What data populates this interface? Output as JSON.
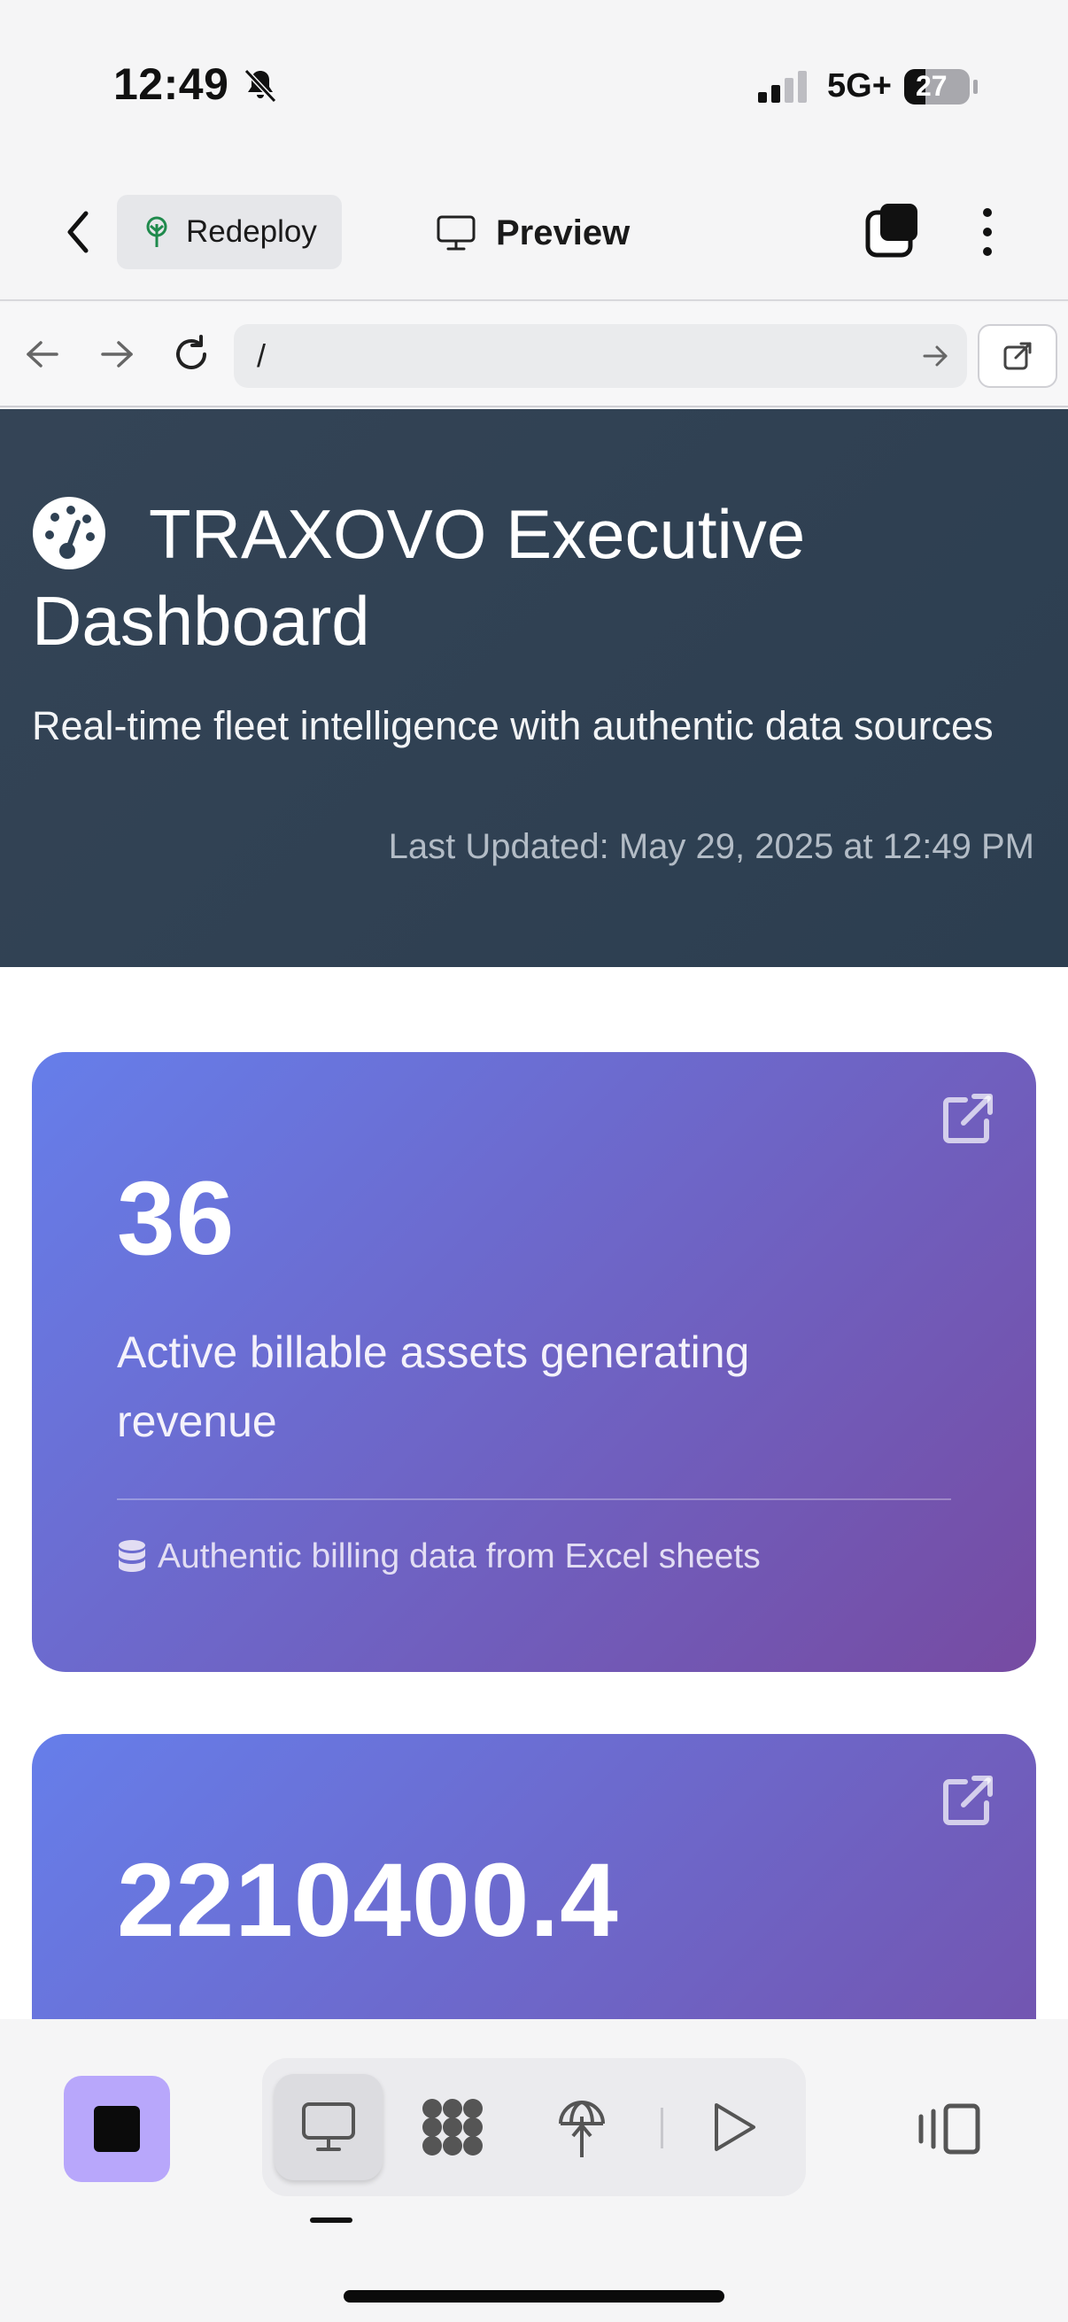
{
  "status_bar": {
    "time": "12:49",
    "network": "5G+",
    "battery": "27",
    "icons": [
      "bell-slash-icon",
      "signal-icon",
      "battery-icon"
    ]
  },
  "toolbar": {
    "redeploy_label": "Redeploy",
    "preview_label": "Preview",
    "icons": [
      "chevron-left-icon",
      "tree-icon",
      "monitor-icon",
      "tabs-icon",
      "more-vertical-icon"
    ]
  },
  "browser": {
    "url": "/",
    "icons": [
      "arrow-left-icon",
      "arrow-right-icon",
      "reload-icon",
      "go-arrow-icon",
      "external-link-icon"
    ]
  },
  "page": {
    "hero": {
      "title": "TRAXOVO Executive Dashboard",
      "subtitle": "Real-time fleet intelligence with authentic data sources",
      "updated": "Last Updated: May 29, 2025 at 12:49 PM",
      "icon": "gauge-icon",
      "bg_color": "#2c3e50"
    },
    "cards": [
      {
        "value": "36",
        "description": "Active billable assets generating revenue",
        "source": "Authentic billing data from Excel sheets",
        "source_icon": "database-icon"
      },
      {
        "value": "2210400.4"
      }
    ],
    "card_gradient": [
      "#667eea",
      "#764ba2"
    ]
  },
  "bottom_bar": {
    "accent_color": "#b8a7fb",
    "icons": [
      "stop-icon",
      "monitor-icon",
      "network-icon",
      "deploy-icon",
      "play-icon",
      "side-panel-icon"
    ]
  }
}
